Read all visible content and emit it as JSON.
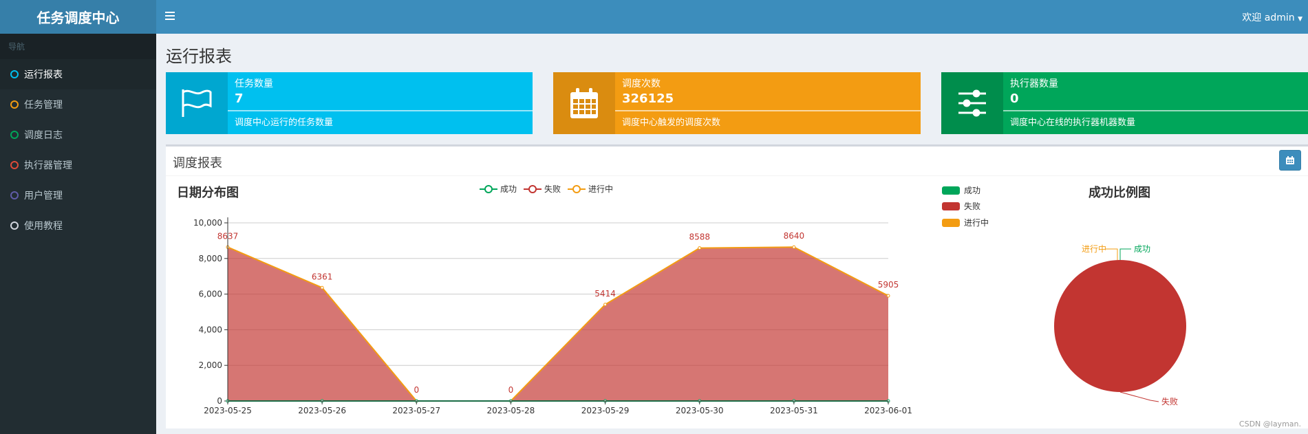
{
  "brand": "任务调度中心",
  "sidebar": {
    "header": "导航",
    "items": [
      {
        "label": "运行报表",
        "color": "#00c0ef"
      },
      {
        "label": "任务管理",
        "color": "#f39c12"
      },
      {
        "label": "调度日志",
        "color": "#00a65a"
      },
      {
        "label": "执行器管理",
        "color": "#dd4b39"
      },
      {
        "label": "用户管理",
        "color": "#605ca8"
      },
      {
        "label": "使用教程",
        "color": "#d2d6de"
      }
    ]
  },
  "topbar": {
    "menu_icon": "hamburger-icon",
    "user_menu": "欢迎 admin"
  },
  "page_title": "运行报表",
  "info_boxes": [
    {
      "label": "任务数量",
      "number": "7",
      "desc": "调度中心运行的任务数量",
      "icon": "flag-icon",
      "bg": "#00c0ef",
      "icon_bg": "#00a7d0"
    },
    {
      "label": "调度次数",
      "number": "326125",
      "desc": "调度中心触发的调度次数",
      "icon": "calendar-icon",
      "bg": "#f39c12",
      "icon_bg": "#da8c10"
    },
    {
      "label": "执行器数量",
      "number": "0",
      "desc": "调度中心在线的执行器机器数量",
      "icon": "sliders-icon",
      "bg": "#00a65a",
      "icon_bg": "#008d4c"
    }
  ],
  "panel": {
    "title": "调度报表",
    "calendar_icon": "calendar-icon"
  },
  "line_legend": [
    "成功",
    "失败",
    "进行中"
  ],
  "pie_legend": [
    "成功",
    "失败",
    "进行中"
  ],
  "colors": {
    "success": "#00a65a",
    "fail": "#c23531",
    "running": "#f39c12"
  },
  "watermark": "CSDN @layman.",
  "chart_data": [
    {
      "type": "area",
      "title": "日期分布图",
      "categories": [
        "2023-05-25",
        "2023-05-26",
        "2023-05-27",
        "2023-05-28",
        "2023-05-29",
        "2023-05-30",
        "2023-05-31",
        "2023-06-01"
      ],
      "series": [
        {
          "name": "成功",
          "values": [
            0,
            0,
            0,
            0,
            0,
            0,
            0,
            0
          ]
        },
        {
          "name": "失败",
          "values": [
            8637,
            6361,
            0,
            0,
            5414,
            8588,
            8640,
            5905
          ]
        },
        {
          "name": "进行中",
          "values": [
            0,
            0,
            0,
            0,
            0,
            0,
            0,
            0
          ]
        }
      ],
      "ylim": [
        0,
        10000
      ],
      "yticks": [
        "0",
        "2,000",
        "4,000",
        "6,000",
        "8,000",
        "10,000"
      ],
      "data_labels": [
        "8637",
        "6361",
        "0",
        "0",
        "5414",
        "8588",
        "8640",
        "5905"
      ],
      "grid": true,
      "legend": "top-center"
    },
    {
      "type": "pie",
      "title": "成功比例图",
      "labels": [
        "成功",
        "失败",
        "进行中"
      ],
      "values": [
        0,
        48545,
        0
      ],
      "legend": "top-left"
    }
  ]
}
